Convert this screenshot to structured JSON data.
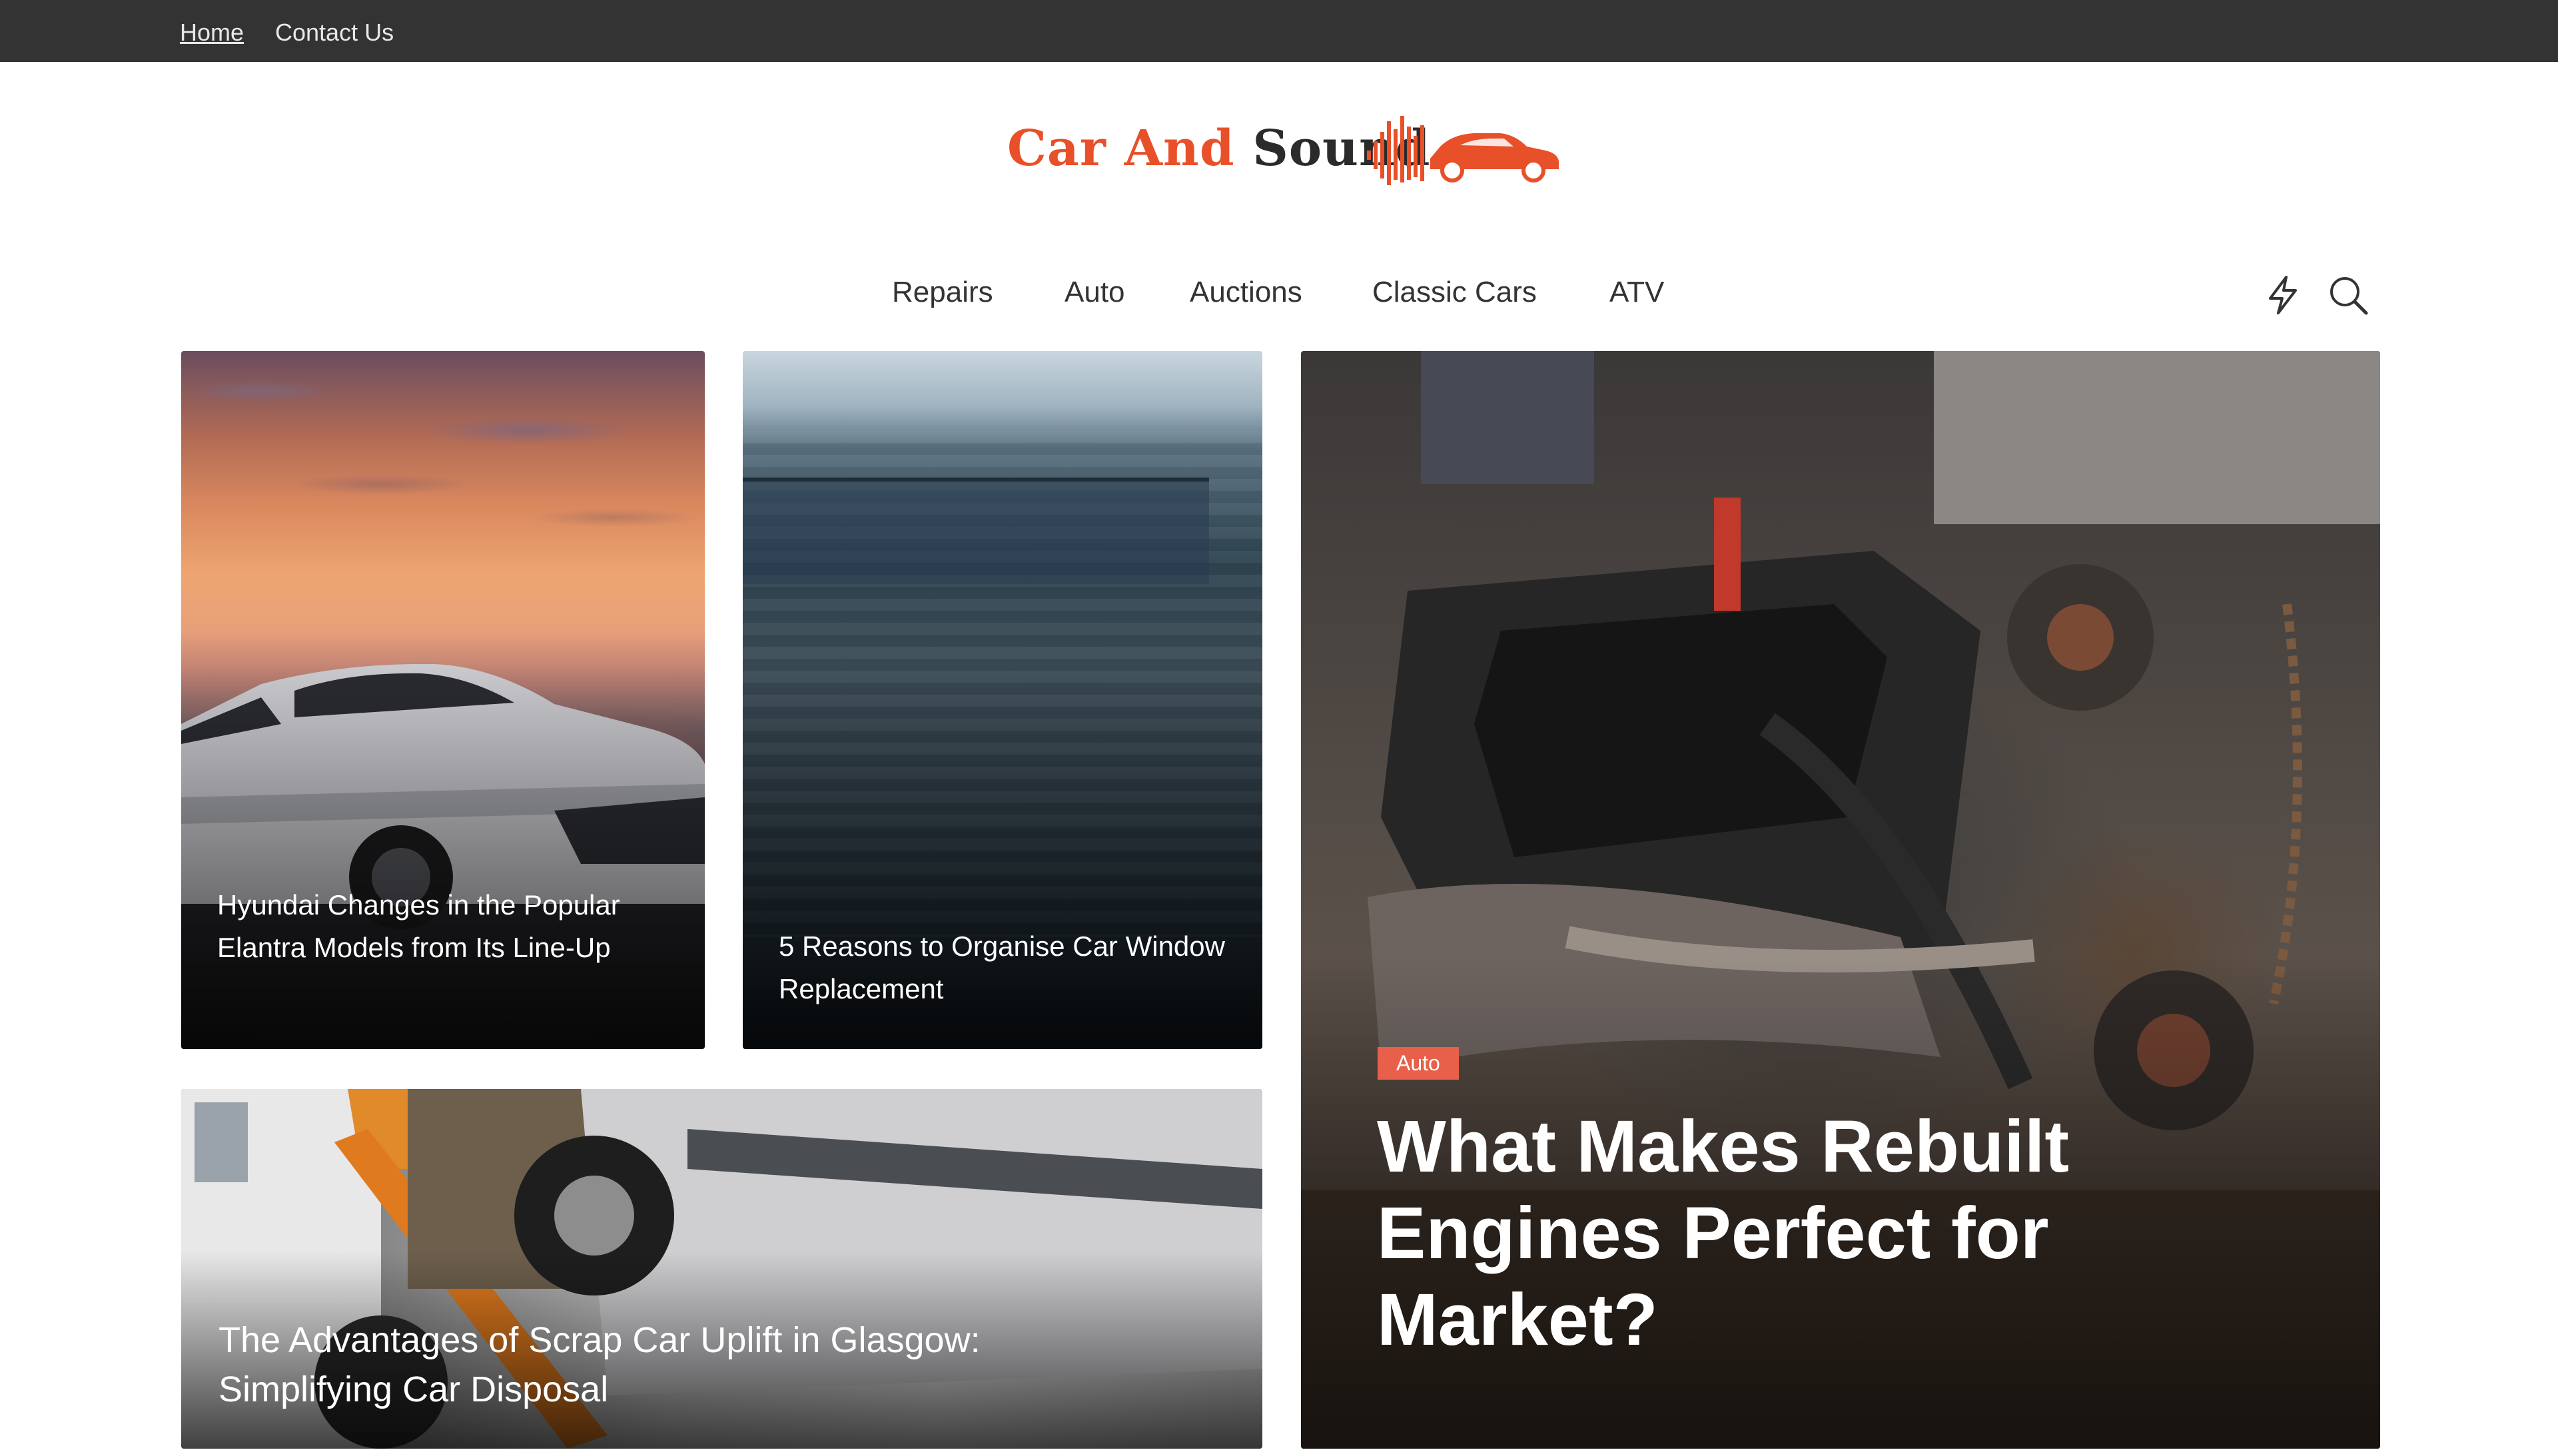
{
  "topbar": {
    "links": [
      "Home",
      "Contact Us"
    ]
  },
  "logo": {
    "word1": "Car",
    "word2": "And",
    "word3": "Sound",
    "accent_color": "#e8502a"
  },
  "nav": {
    "items": [
      "Repairs",
      "Auto",
      "Auctions",
      "Classic Cars",
      "ATV"
    ],
    "icons": [
      "bolt-icon",
      "search-icon"
    ]
  },
  "posts": [
    {
      "title": "Hyundai Changes in the Popular Elantra Models from Its Line-Up"
    },
    {
      "title": "5 Reasons to Organise Car Window Replacement"
    },
    {
      "title": "The Advantages of Scrap Car Uplift in Glasgow: Simplifying Car Disposal"
    }
  ],
  "featured": {
    "category": "Auto",
    "title": "What Makes Rebuilt Engines Perfect for Market?",
    "badge_color": "#e8604a"
  }
}
